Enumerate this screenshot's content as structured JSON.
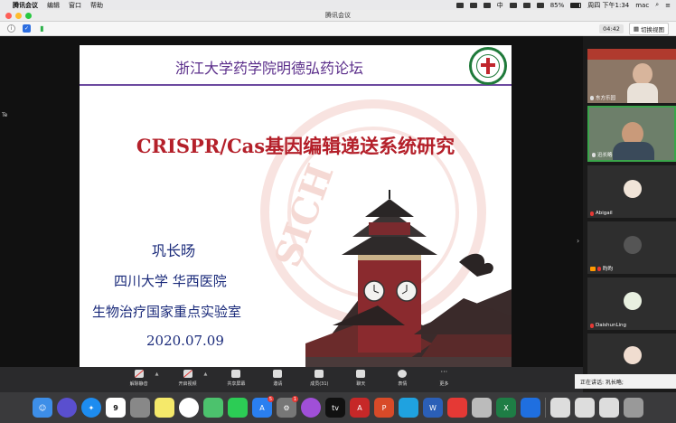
{
  "menubar": {
    "app_name": "腾讯会议",
    "menus": [
      "编辑",
      "窗口",
      "帮助"
    ],
    "input_method": "中",
    "battery": "85%",
    "clock": "周四 下午1:34",
    "user": "mac"
  },
  "window": {
    "title": "腾讯会议",
    "timer": "04:42",
    "switch_view_label": "切换视图"
  },
  "sidebar_left_label": "Te",
  "slide": {
    "header_title": "浙江大学药学院明德弘药论坛",
    "main_title": "CRISPR/Cas基因编辑递送系统研究",
    "speaker": "巩长旸",
    "affiliation_1": "四川大学 华西医院",
    "affiliation_2": "生物治疗国家重点实验室",
    "date": "2020.07.09",
    "watermark_text": "SICH"
  },
  "controls": [
    {
      "label": "解除静音",
      "icon": "mic-off-icon"
    },
    {
      "label": "开启视频",
      "icon": "video-off-icon"
    },
    {
      "label": "共享屏幕",
      "icon": "share-screen-icon"
    },
    {
      "label": "邀请",
      "icon": "invite-icon"
    },
    {
      "label": "成员(31)",
      "icon": "members-icon"
    },
    {
      "label": "聊天",
      "icon": "chat-icon"
    },
    {
      "label": "表情",
      "icon": "emoji-icon"
    },
    {
      "label": "更多",
      "icon": "more-icon"
    }
  ],
  "participants": [
    {
      "name": "东方乐园",
      "type": "video",
      "mic": "on"
    },
    {
      "name": "迅长略",
      "type": "video",
      "mic": "on",
      "active": true
    },
    {
      "name": "Abigail",
      "type": "avatar",
      "mic": "off"
    },
    {
      "name": "昀昀",
      "type": "avatar",
      "mic": "off",
      "host": true
    },
    {
      "name": "DaishunLing",
      "type": "avatar",
      "mic": "off"
    },
    {
      "name": "",
      "type": "avatar",
      "mic": "off"
    }
  ],
  "speaking_label": "正在讲话: 巩长略;",
  "dock": {
    "calendar_day": "9",
    "badges": {
      "appstore": "5",
      "prefs": "1"
    }
  },
  "colors": {
    "slide_title_red": "#b4202a",
    "slide_header_purple": "#5a2d8a",
    "slide_text_blue": "#1a2a7a",
    "active_border_green": "#3aa54a"
  }
}
